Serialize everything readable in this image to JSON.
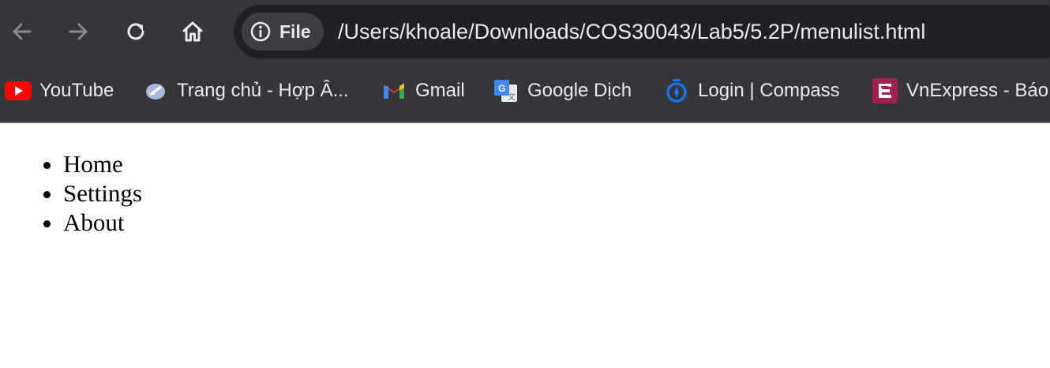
{
  "browser": {
    "address_chip_label": "File",
    "url": "/Users/khoale/Downloads/COS30043/Lab5/5.2P/menulist.html",
    "bookmarks": [
      {
        "label": "YouTube",
        "icon": "youtube-icon"
      },
      {
        "label": "Trang chủ - Hợp Â...",
        "icon": "guitar-icon"
      },
      {
        "label": "Gmail",
        "icon": "gmail-icon"
      },
      {
        "label": "Google Dịch",
        "icon": "google-translate-icon"
      },
      {
        "label": "Login | Compass",
        "icon": "compass-icon"
      },
      {
        "label": "VnExpress - Báo",
        "icon": "vnexpress-icon"
      }
    ],
    "colors": {
      "toolbar": "#35363a",
      "omnibox": "#202124",
      "chip": "#3c3d40",
      "text": "#e8eaed"
    }
  },
  "page": {
    "menu": {
      "items": [
        "Home",
        "Settings",
        "About"
      ]
    }
  }
}
